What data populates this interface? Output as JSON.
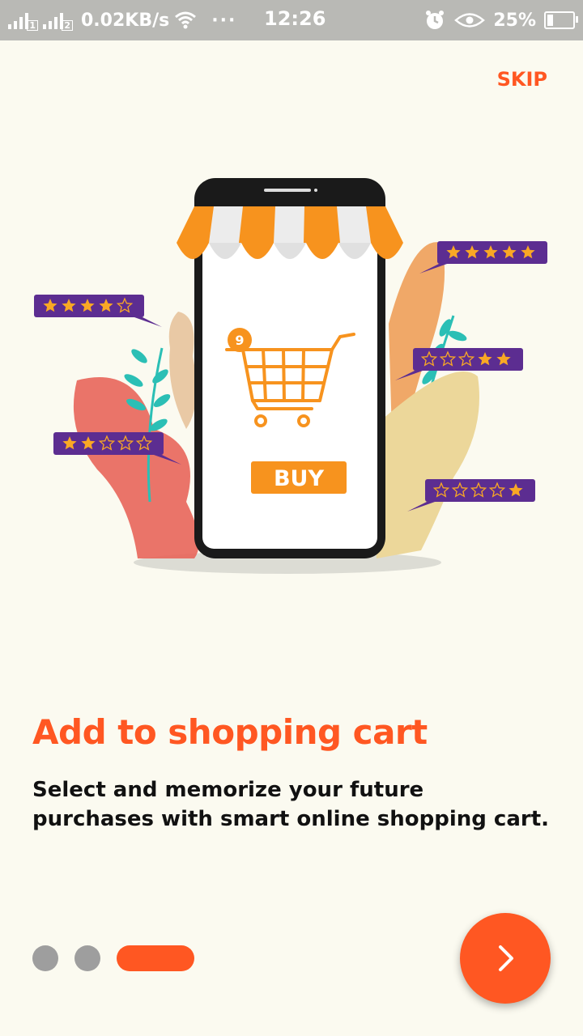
{
  "status_bar": {
    "speed": "0.02KB/s",
    "more": "···",
    "time": "12:26",
    "battery": "25%",
    "battery_level": 0.25,
    "sim1": "1",
    "sim2": "2"
  },
  "onboarding": {
    "skip_label": "SKIP",
    "title": "Add to shopping cart",
    "description": "Select and memorize your future purchases with smart online shopping cart.",
    "illustration": {
      "cart_badge": "9",
      "buy_label": "BUY",
      "ratings": [
        4,
        5,
        2,
        2,
        1
      ]
    },
    "page_indicator": {
      "total": 3,
      "current": 3
    }
  },
  "colors": {
    "accent": "#ff5722",
    "background": "#fbfaf0",
    "awning_orange": "#f7931e",
    "rating_purple": "#5c2d91",
    "star": "#f9a825"
  },
  "icons": {
    "next": "chevron-right-icon",
    "wifi": "wifi-icon",
    "alarm": "alarm-icon",
    "eye": "eye-icon"
  }
}
